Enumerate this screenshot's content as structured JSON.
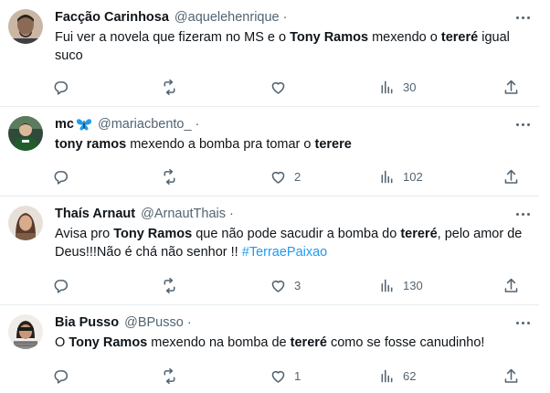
{
  "tweets": [
    {
      "name": "Facção Carinhosa",
      "handle": "@aquelehenrique",
      "dot": "·",
      "text": [
        {
          "t": "Fui ver a novela que fizeram no MS e o "
        },
        {
          "t": "Tony Ramos",
          "b": true
        },
        {
          "t": " mexendo o "
        },
        {
          "t": "tereré",
          "b": true
        },
        {
          "t": " igual suco"
        }
      ],
      "replies": "",
      "retweets": "",
      "likes": "",
      "views": "30"
    },
    {
      "name": "mc",
      "butterfly": true,
      "handle": "@mariacbento_",
      "dot": "·",
      "text": [
        {
          "t": "tony ramos",
          "b": true
        },
        {
          "t": " mexendo a bomba pra tomar o "
        },
        {
          "t": "terere",
          "b": true
        }
      ],
      "replies": "",
      "retweets": "",
      "likes": "2",
      "views": "102"
    },
    {
      "name": "Thaís Arnaut",
      "handle": "@ArnautThais",
      "dot": "·",
      "text": [
        {
          "t": "Avisa pro "
        },
        {
          "t": "Tony Ramos",
          "b": true
        },
        {
          "t": " que não pode sacudir a bomba do "
        },
        {
          "t": "tereré",
          "b": true
        },
        {
          "t": ", pelo amor de Deus!!!Não é chá não senhor !! "
        },
        {
          "t": "#TerraePaixao",
          "h": true
        }
      ],
      "replies": "",
      "retweets": "",
      "likes": "3",
      "views": "130"
    },
    {
      "name": "Bia Pusso",
      "handle": "@BPusso",
      "dot": "·",
      "text": [
        {
          "t": "O "
        },
        {
          "t": "Tony Ramos",
          "b": true
        },
        {
          "t": " mexendo na bomba de "
        },
        {
          "t": "tereré",
          "b": true
        },
        {
          "t": " como se fosse canudinho!"
        }
      ],
      "replies": "",
      "retweets": "",
      "likes": "1",
      "views": "62"
    }
  ],
  "icons": {
    "reply": "reply-icon",
    "retweet": "retweet-icon",
    "like": "heart-icon",
    "views": "views-icon",
    "share": "share-icon",
    "more": "more-icon"
  },
  "colors": {
    "text": "#0f1419",
    "muted": "#536471",
    "hashtag": "#1d9bf0",
    "divider": "#e6ecf0",
    "butterfly": "#1d9bf0"
  }
}
